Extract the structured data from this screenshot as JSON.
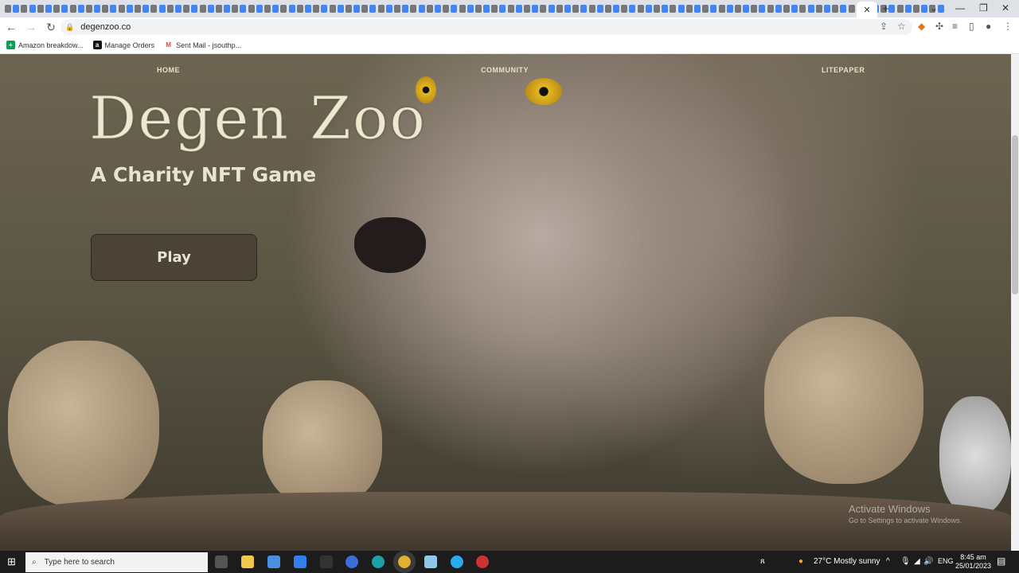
{
  "browser": {
    "url": "degenzoo.co",
    "active_tab_close": "✕",
    "new_tab": "+",
    "bookmarks": [
      {
        "label": "Amazon breakdow...",
        "icon": "sheets-icon",
        "color": "#0f9d58"
      },
      {
        "label": "Manage Orders",
        "icon": "amazon-icon",
        "color": "#111111"
      },
      {
        "label": "Sent Mail - jsouthp...",
        "icon": "gmail-icon",
        "color": "#ea4335"
      }
    ]
  },
  "site": {
    "nav": [
      "HOME",
      "COMMUNITY",
      "LITEPAPER"
    ],
    "logo": "Degen Zoo",
    "tagline": "A Charity NFT Game",
    "play_label": "Play"
  },
  "watermark": {
    "title": "Activate Windows",
    "subtitle": "Go to Settings to activate Windows."
  },
  "taskbar": {
    "search_placeholder": "Type here to search",
    "weather": "27°C  Mostly sunny",
    "lang": "ENG",
    "time": "8:45 am",
    "date": "25/01/2023"
  }
}
